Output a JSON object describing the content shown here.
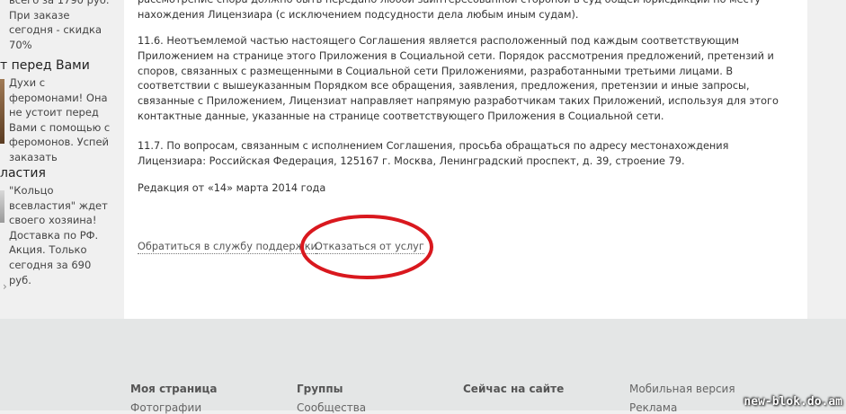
{
  "sidebar": {
    "promo_top": {
      "text": "всего за 1790 руб. При заказе сегодня - скидка 70%"
    },
    "section1_title": "т перед Вами",
    "ad1": {
      "text": "Духи с феромонами! Она не устоит перед Вами с помощью с феромонов. Успей заказать"
    },
    "section2_title": "ластия",
    "ad2": {
      "text": "\"Кольцо всевластия\" ждет своего хозяина! Доставка по РФ. Акция. Только сегодня за 690 руб."
    },
    "arrow": "›"
  },
  "agreement": {
    "para_top": "рассмотрение спора должно быть передано любой заинтересованной стороной в суд общей юрисдикции по месту нахождения Лицензиара (с исключением подсудности дела любым иным судам).",
    "para_11_6": "11.6. Неотъемлемой частью настоящего Соглашения является расположенный под каждым соответствующим Приложением на странице этого Приложения в Социальной сети. Порядок рассмотрения предложений, претензий и споров, связанных с размещенными в Социальной сети Приложениями, разработанными третьими лицами. В соответствии с вышеуказанным Порядком все обращения, заявления, предложения, претензии и иные запросы, связанные с Приложением, Лицензиат направляет напрямую разработчикам таких Приложений, используя для этого контактные данные, указанные на странице соответствующего Приложения в Социальной сети.",
    "para_11_7": "11.7. По вопросам, связанным с исполнением Соглашения, просьба обращаться по адресу местонахождения Лицензиара: Российская Федерация, 125167 г. Москва, Ленинградский проспект, д. 39, строение 79.",
    "edition": "Редакция от «14» марта 2014 года"
  },
  "actions": {
    "support_link": "Обратиться в службу поддержки",
    "decline_link": "Отказаться от услуг",
    "highlight_color": "#d9181e"
  },
  "footer": {
    "col1_title": "Моя страница",
    "col1_item": "Фотографии",
    "col2_title": "Группы",
    "col2_item": "Сообщества",
    "col3_title": "Сейчас на сайте",
    "col4_title": "Мобильная версия",
    "col4_item": "Реклама"
  },
  "watermark": "new-blok.do.am"
}
